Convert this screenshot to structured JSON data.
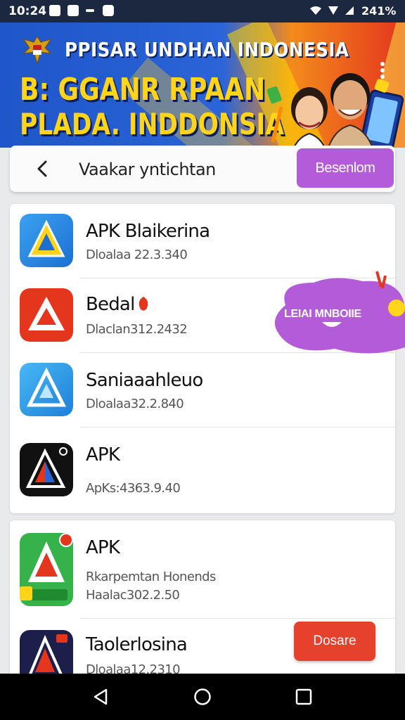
{
  "status_bar": {
    "time": "10:24",
    "battery": "241%",
    "icons": [
      "notification-icon",
      "gallery-icon",
      "dots-icon",
      "app-icon",
      "wifi-icon",
      "signal-icon",
      "signal-icon-2"
    ]
  },
  "banner": {
    "title": "PPISAR UNDHAN INDONESIA",
    "line1": "B: GGANR RPAAN",
    "line2": "PLADA. INDDONSIA",
    "colors": {
      "blue": "#1f56c9",
      "orange": "#f38b1c",
      "red": "#e4351d",
      "yellow": "#ffd419"
    }
  },
  "search": {
    "query": "Vaakar yntichtan",
    "button_label": "Besenlom"
  },
  "apps": [
    {
      "name": "APK Blaikerina",
      "sub": "Dloalaa 22.3.340",
      "icon": "apk-blue-yellow-icon"
    },
    {
      "name": "Bedal",
      "sub": "Dlaclan312.2432",
      "icon": "apk-red-icon"
    },
    {
      "name": "Saniaaahleuo",
      "sub": "Dloalaa32.2.840",
      "icon": "apk-light-blue-icon"
    },
    {
      "name": "APK",
      "sub": "ApKs:4363.9.40",
      "icon": "apk-black-icon"
    },
    {
      "name": "APK",
      "sub": "Rkarpemtan Honends",
      "sub2": "Haalac302.2.50",
      "icon": "apk-green-icon"
    },
    {
      "name": "Taolerlosina",
      "sub": "Dloalaa12.2310",
      "icon": "apk-dark-navy-icon"
    }
  ],
  "promo": {
    "label": "LEIAI MNBOIIE"
  },
  "download_button": {
    "label": "Dosare"
  },
  "accent": {
    "purple": "#b35bd9",
    "red": "#e6412c"
  }
}
